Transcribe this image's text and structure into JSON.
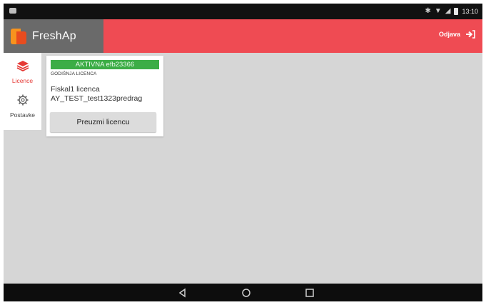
{
  "status_bar": {
    "time": "13:10",
    "icons": [
      "bluetooth-icon",
      "wifi-icon",
      "signal-icon",
      "battery-icon"
    ]
  },
  "header": {
    "app_title": "FreshAp",
    "logout_label": "Odjava",
    "accent_color": "#ef4b53"
  },
  "sidebar": {
    "items": [
      {
        "label": "Licence",
        "icon": "layers-icon",
        "active": true
      },
      {
        "label": "Postavke",
        "icon": "gear-icon",
        "active": false
      }
    ]
  },
  "license_card": {
    "status_badge": "AKTIVNA efb23366",
    "license_type": "GODIŠNJA LICENCA",
    "license_name": "Fiskal1 licenca",
    "license_user": "AY_TEST_test1323predrag",
    "download_button": "Preuzmi licencu",
    "status_color": "#3cad46"
  },
  "nav_bar": {
    "buttons": [
      "back-icon",
      "home-icon",
      "recents-icon"
    ]
  }
}
